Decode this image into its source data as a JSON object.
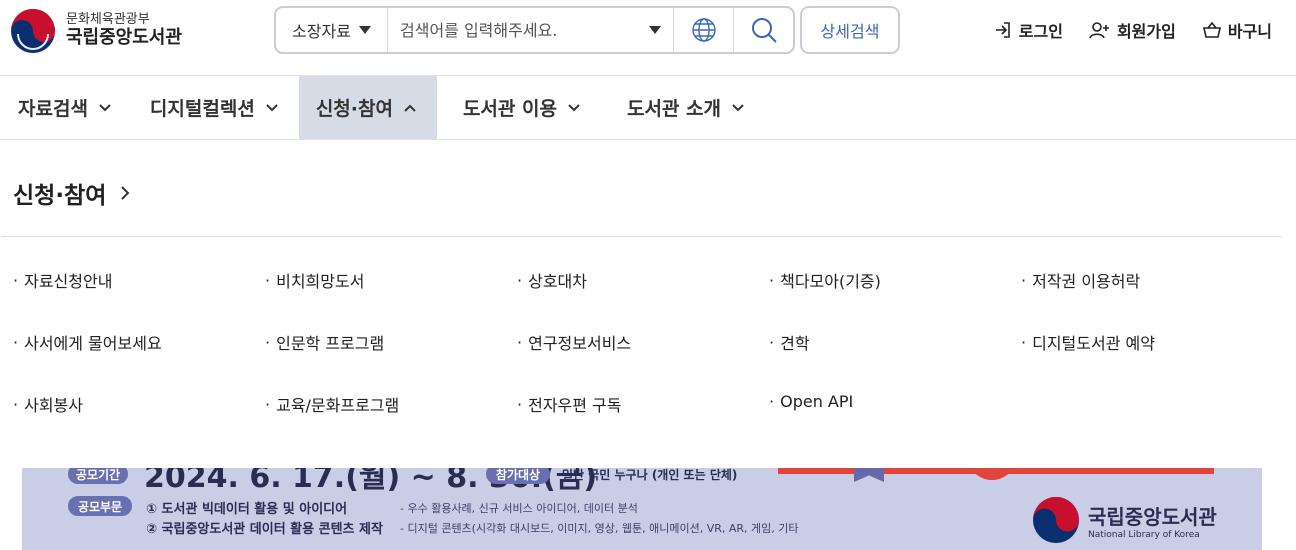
{
  "header": {
    "ministry": "문화체육관광부",
    "library_name": "국립중앙도서관",
    "search": {
      "category_selected": "소장자료",
      "placeholder": "검색어를 입력해주세요.",
      "icons": [
        "caret-down-icon",
        "globe-icon",
        "search-icon"
      ]
    },
    "advanced_search_label": "상세검색",
    "utilities": [
      {
        "label": "로그인",
        "icon": "login-icon"
      },
      {
        "label": "회원가입",
        "icon": "user-plus-icon"
      },
      {
        "label": "바구니",
        "icon": "basket-icon"
      }
    ]
  },
  "gnb": {
    "items": [
      {
        "label": "자료검색",
        "expanded": false
      },
      {
        "label": "디지털컬렉션",
        "expanded": false
      },
      {
        "label": "신청·참여",
        "expanded": true
      },
      {
        "label": "도서관 이용",
        "expanded": false
      },
      {
        "label": "도서관 소개",
        "expanded": false
      }
    ]
  },
  "dropdown": {
    "title": "신청·참여",
    "bullet": "·",
    "columns": [
      [
        "자료신청안내",
        "사서에게 물어보세요",
        "사회봉사"
      ],
      [
        "비치희망도서",
        "인문학 프로그램",
        "교육/문화프로그램"
      ],
      [
        "상호대차",
        "연구정보서비스",
        "전자우편 구독"
      ],
      [
        "책다모아(기증)",
        "견학",
        "Open API"
      ],
      [
        "저작권 이용허락",
        "디지털도서관 예약"
      ]
    ]
  },
  "banner": {
    "period_label": "공모기간",
    "period": "2024. 6. 17.(월) ~ 8. 30.(금)",
    "target_label": "참가대상",
    "target": "일반 국민 누구나 (개인 또는 단체)",
    "category_label": "공모부문",
    "category_1": "① 도서관 빅데이터 활용 및 아이디어",
    "category_2": "② 국립중앙도서관 데이터 활용 콘텐츠 제작",
    "detail_1": "- 우수 활용사례, 신규 서비스 아이디어, 데이터 분석",
    "detail_2": "- 디지털 콘텐츠(시각화 대시보드, 이미지, 영상, 웹툰, 애니메이션, VR, AR, 게임, 기타",
    "logo_name": "국립중앙도서관",
    "logo_en": "National Library of Korea"
  },
  "colors": {
    "accent_blue": "#3a66b8",
    "active_tab_bg": "#d5dce6",
    "banner_bg": "#c9cde6",
    "banner_red": "#e0443a",
    "taeguk_red": "#c8102e",
    "taeguk_blue": "#0a2f6e"
  }
}
